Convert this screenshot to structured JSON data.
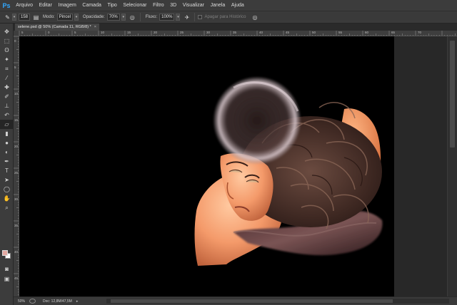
{
  "app": {
    "logo": "Ps"
  },
  "menu": [
    "Arquivo",
    "Editar",
    "Imagem",
    "Camada",
    "Tipo",
    "Selecionar",
    "Filtro",
    "3D",
    "Visualizar",
    "Janela",
    "Ajuda"
  ],
  "options": {
    "brush_size": "158",
    "mode_label": "Modo:",
    "mode_value": "Pincel",
    "opacity_label": "Opacidade:",
    "opacity_value": "70%",
    "flow_label": "Fluxo:",
    "flow_value": "100%",
    "erase_history_label": "Apagar para Histórico"
  },
  "document_tab": {
    "title": "selene.psd @ 50% (Camada 11, RGB/8) *",
    "close": "×"
  },
  "ruler": {
    "top_labels": [
      "5",
      "0",
      "5",
      "10",
      "15",
      "20",
      "25",
      "30",
      "35",
      "40",
      "45",
      "50",
      "55",
      "60",
      "65",
      "70"
    ],
    "left_labels": [
      "0",
      "5",
      "10",
      "15",
      "20",
      "25",
      "30",
      "35",
      "40",
      "45",
      "50"
    ]
  },
  "status": {
    "zoom": "50%",
    "doc_size": "Doc: 12,8M/47,5M",
    "arrow": "▸"
  },
  "colors": {
    "foreground": "#e3a9a2",
    "background": "#ffffff",
    "accent": "#31a8ff"
  },
  "tools": [
    "move-tool",
    "marquee-tool",
    "lasso-tool",
    "quick-selection-tool",
    "crop-tool",
    "eyedropper-tool",
    "healing-brush-tool",
    "brush-tool",
    "clone-stamp-tool",
    "history-brush-tool",
    "eraser-tool",
    "gradient-tool",
    "blur-tool",
    "dodge-tool",
    "pen-tool",
    "type-tool",
    "path-selection-tool",
    "shape-tool",
    "hand-tool",
    "zoom-tool"
  ]
}
